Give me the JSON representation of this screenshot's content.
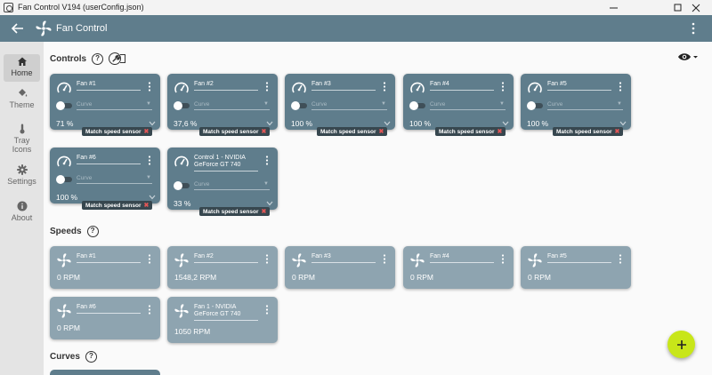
{
  "window": {
    "title": "Fan Control V194 (userConfig.json)"
  },
  "appbar": {
    "title": "Fan Control"
  },
  "sidebar": {
    "items": [
      {
        "label": "Home",
        "icon": "home-icon",
        "active": true
      },
      {
        "label": "Theme",
        "icon": "paint-bucket-icon"
      },
      {
        "label": "Tray Icons",
        "icon": "thermometer-icon"
      },
      {
        "label": "Settings",
        "icon": "gear-icon"
      },
      {
        "label": "About",
        "icon": "info-icon"
      }
    ]
  },
  "sections": {
    "controls": "Controls",
    "speeds": "Speeds",
    "curves": "Curves",
    "help": "?"
  },
  "controls": [
    {
      "name": "Fan #1",
      "curve": "Curve",
      "value": "71 %",
      "badge": "Match speed sensor"
    },
    {
      "name": "Fan #2",
      "curve": "Curve",
      "value": "37,6 %",
      "badge": "Match speed sensor"
    },
    {
      "name": "Fan #3",
      "curve": "Curve",
      "value": "100 %",
      "badge": "Match speed sensor"
    },
    {
      "name": "Fan #4",
      "curve": "Curve",
      "value": "100 %",
      "badge": "Match speed sensor"
    },
    {
      "name": "Fan #5",
      "curve": "Curve",
      "value": "100 %",
      "badge": "Match speed sensor"
    },
    {
      "name": "Fan #6",
      "curve": "Curve",
      "value": "100 %",
      "badge": "Match speed sensor"
    },
    {
      "name": "Control 1 - NVIDIA GeForce GT 740",
      "curve": "Curve",
      "value": "33 %",
      "badge": "Match speed sensor"
    }
  ],
  "speeds": [
    {
      "name": "Fan #1",
      "value": "0 RPM"
    },
    {
      "name": "Fan #2",
      "value": "1548,2 RPM"
    },
    {
      "name": "Fan #3",
      "value": "0 RPM"
    },
    {
      "name": "Fan #4",
      "value": "0 RPM"
    },
    {
      "name": "Fan #5",
      "value": "0 RPM"
    },
    {
      "name": "Fan #6",
      "value": "0 RPM"
    },
    {
      "name": "Fan 1 - NVIDIA GeForce GT 740",
      "value": "1050 RPM"
    }
  ],
  "colors": {
    "appbar": "#5f7d8c",
    "control_card": "#5f7d8c",
    "speed_card": "#8ea4b0",
    "fab": "#c8e619",
    "badge": "#37474f",
    "badge_x": "#e05656"
  }
}
